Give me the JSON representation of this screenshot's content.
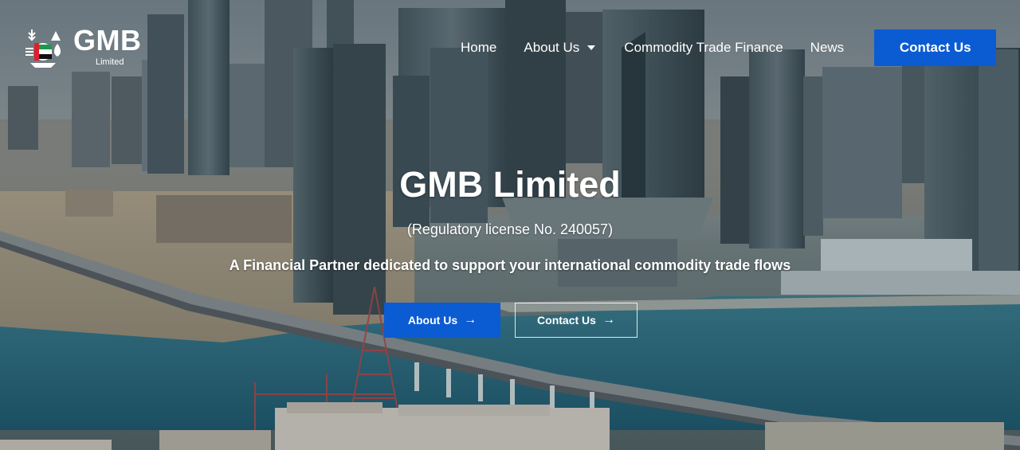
{
  "brand": {
    "name": "GMB",
    "sub": "Limited"
  },
  "nav": {
    "home": "Home",
    "about": "About Us",
    "ctf": "Commodity Trade Finance",
    "news": "News",
    "contact": "Contact Us"
  },
  "hero": {
    "title": "GMB Limited",
    "license": "(Regulatory license No. 240057)",
    "tagline": "A Financial Partner dedicated to support your international commodity trade flows",
    "buttons": {
      "about": "About Us",
      "contact": "Contact Us",
      "arrow": "→"
    }
  },
  "colors": {
    "accent": "#0b5bd3",
    "text": "#ffffff"
  },
  "icons": {
    "caret": "chevron-down-icon",
    "arrow": "arrow-right-icon"
  }
}
